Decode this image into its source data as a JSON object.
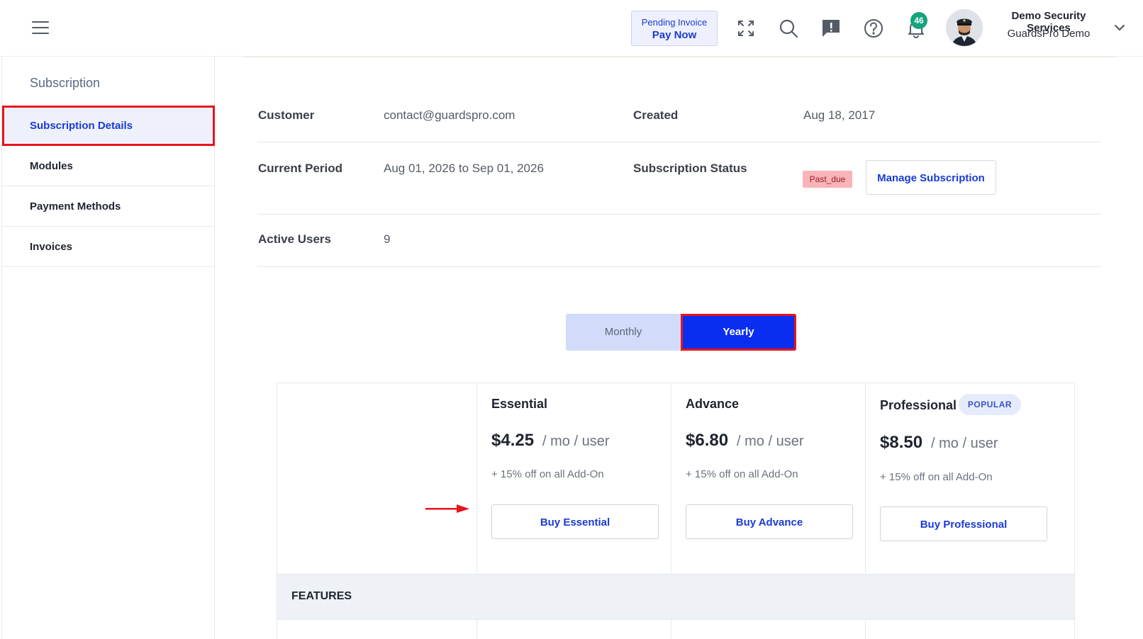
{
  "header": {
    "pending_invoice": "Pending Invoice",
    "pay_now": "Pay Now",
    "notification_count": "46",
    "company_name": "Demo Security Services",
    "org_name": "GuardsPro Demo",
    "icons": [
      "menu-icon",
      "expand-icon",
      "search-icon",
      "feedback-icon",
      "help-icon",
      "bell-icon",
      "chevron-down-icon"
    ]
  },
  "sidebar": {
    "title": "Subscription",
    "items": [
      {
        "label": "Subscription Details",
        "active": true
      },
      {
        "label": "Modules"
      },
      {
        "label": "Payment Methods"
      },
      {
        "label": "Invoices"
      }
    ]
  },
  "details": {
    "customer_label": "Customer",
    "customer_value": "contact@guardspro.com",
    "created_label": "Created",
    "created_value": "Aug 18, 2017",
    "period_label": "Current Period",
    "period_value": "Aug 01, 2026 to Sep 01, 2026",
    "status_label": "Subscription Status",
    "status_value": "Past_due",
    "manage_button": "Manage Subscription",
    "users_label": "Active Users",
    "users_value": "9"
  },
  "billing_toggle": {
    "monthly": "Monthly",
    "yearly": "Yearly",
    "selected": "Yearly"
  },
  "plans": [
    {
      "name": "Essential",
      "price": "$4.25",
      "per": "/ mo / user",
      "addon": "+ 15% off on all Add-On",
      "button": "Buy Essential"
    },
    {
      "name": "Advance",
      "price": "$6.80",
      "per": "/ mo / user",
      "addon": "+ 15% off on all Add-On",
      "button": "Buy Advance"
    },
    {
      "name": "Professional",
      "badge": "POPULAR",
      "price": "$8.50",
      "per": "/ mo / user",
      "addon": "+ 15% off on all Add-On",
      "button": "Buy Professional"
    }
  ],
  "features_heading": "FEATURES",
  "colors": {
    "accent": "#1a3bd6",
    "highlight": "#e8141c",
    "yearly_bg": "#0a2ef0",
    "badge_green": "#16a37f"
  }
}
